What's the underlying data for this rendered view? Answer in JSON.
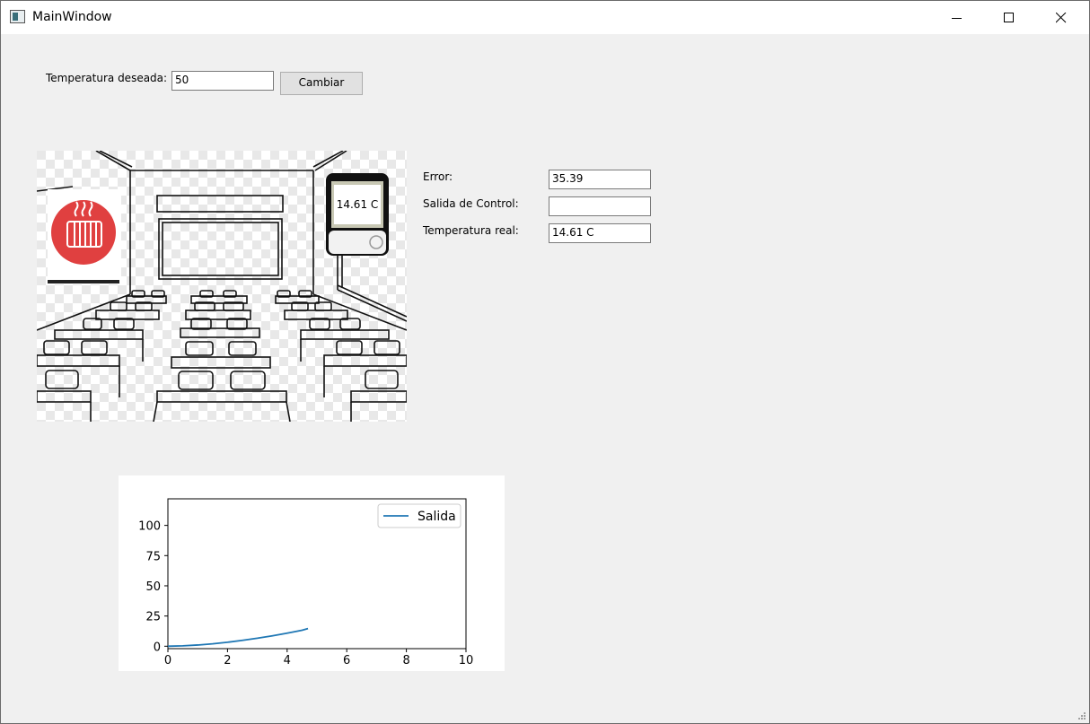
{
  "window": {
    "title": "MainWindow",
    "icons": {
      "app": "app-window-icon",
      "minimize": "minimize-icon",
      "maximize": "maximize-icon",
      "close": "close-icon"
    }
  },
  "controls": {
    "desired_label": "Temperatura deseada:",
    "desired_value": "50",
    "change_button": "Cambiar"
  },
  "readouts": {
    "error_label": "Error:",
    "error_value": "35.39",
    "control_label": "Salida de Control:",
    "control_value": "",
    "real_label": "Temperatura real:",
    "real_value": "14.61 C"
  },
  "scene": {
    "thermometer_display": "14.61 C",
    "icons": {
      "heater": "heater-icon",
      "thermometer": "thermometer-icon",
      "classroom": "classroom-illustration"
    },
    "heater_color": "#e04040"
  },
  "chart_data": {
    "type": "line",
    "xlim": [
      0,
      10
    ],
    "ylim": [
      -2,
      122
    ],
    "xticks": [
      "0",
      "2",
      "4",
      "6",
      "8",
      "10"
    ],
    "yticks": [
      "0",
      "25",
      "50",
      "75",
      "100"
    ],
    "series": [
      {
        "name": "Salida",
        "color": "#1f77b4",
        "x": [
          0,
          0.5,
          1,
          1.5,
          2,
          2.5,
          3,
          3.5,
          4,
          4.5,
          4.7
        ],
        "y": [
          0,
          0.3,
          1.0,
          2.0,
          3.3,
          4.9,
          6.6,
          8.6,
          10.8,
          13.2,
          14.6
        ]
      }
    ],
    "legend": "top-right",
    "grid": false
  }
}
